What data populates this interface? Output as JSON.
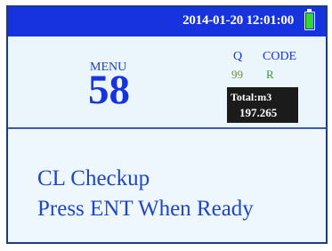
{
  "status_bar": {
    "datetime": "2014-01-20 12:01:00",
    "battery_icon": "battery-full-icon",
    "background_color": "#1733e0"
  },
  "menu": {
    "label": "MENU",
    "number": "58"
  },
  "readings": {
    "q_label": "Q",
    "code_label": "CODE",
    "q_value": "99",
    "code_value": "R"
  },
  "total": {
    "label": "Total:m3",
    "value": "197.265"
  },
  "messages": {
    "line1": "CL Checkup",
    "line2": "Press ENT When Ready"
  },
  "colors": {
    "accent": "#1733e0",
    "text_blue": "#1f45c8",
    "panel_bg": "#eaf5fc",
    "total_bg": "#1b1b1b",
    "battery": "#33d633"
  }
}
